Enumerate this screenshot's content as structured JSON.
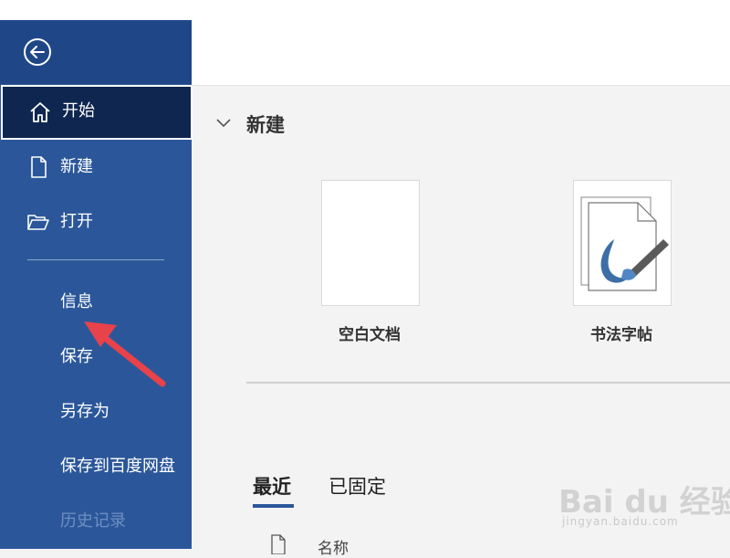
{
  "sidebar": {
    "back_icon": "back-arrow-circle-icon",
    "items": [
      {
        "label": "开始",
        "icon": "home-icon",
        "active": true
      },
      {
        "label": "新建",
        "icon": "document-icon"
      },
      {
        "label": "打开",
        "icon": "folder-open-icon"
      }
    ],
    "secondary": [
      {
        "label": "信息"
      },
      {
        "label": "保存"
      },
      {
        "label": "另存为"
      },
      {
        "label": "保存到百度网盘"
      },
      {
        "label": "历史记录",
        "disabled": true
      }
    ]
  },
  "main": {
    "new_section": {
      "title": "新建",
      "chevron_icon": "chevron-down-icon"
    },
    "templates": [
      {
        "label": "空白文档"
      },
      {
        "label": "书法字帖"
      }
    ],
    "tabs": [
      {
        "label": "最近",
        "active": true
      },
      {
        "label": "已固定"
      }
    ],
    "list_header": {
      "name_label": "名称"
    }
  },
  "watermark": {
    "brand": "Bai du 经验",
    "url": "jingyan.baidu.com"
  },
  "colors": {
    "sidebar": "#2b579a",
    "active_item": "#0f2650",
    "annotation_arrow": "#e8424a"
  }
}
